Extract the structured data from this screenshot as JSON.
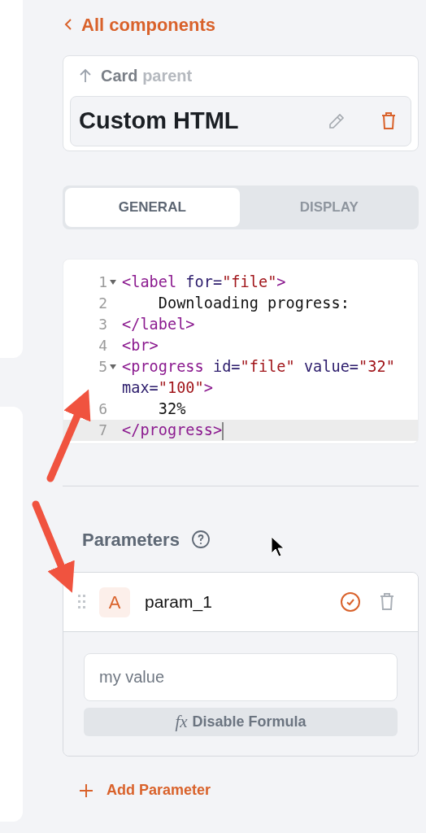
{
  "back_link": {
    "label": "All components"
  },
  "parent_card": {
    "type_label": "Card",
    "suffix": "parent",
    "component_name": "Custom HTML"
  },
  "tabs": [
    {
      "label": "GENERAL",
      "selected": true
    },
    {
      "label": "DISPLAY",
      "selected": false
    }
  ],
  "code_editor": {
    "lines": [
      {
        "number": "1",
        "fold": true,
        "active": false,
        "tokens": [
          {
            "kind": "tag",
            "text": "<label"
          },
          {
            "kind": "attr",
            "text": " for="
          },
          {
            "kind": "string",
            "text": "\"file\""
          },
          {
            "kind": "tag",
            "text": ">"
          }
        ]
      },
      {
        "number": "2",
        "fold": false,
        "active": false,
        "tokens": [
          {
            "kind": "text",
            "text": "    Downloading progress:"
          }
        ]
      },
      {
        "number": "3",
        "fold": false,
        "active": false,
        "tokens": [
          {
            "kind": "tag",
            "text": "</label>"
          }
        ]
      },
      {
        "number": "4",
        "fold": false,
        "active": false,
        "tokens": [
          {
            "kind": "tag",
            "text": "<br>"
          }
        ]
      },
      {
        "number": "5",
        "fold": true,
        "active": false,
        "tokens": [
          {
            "kind": "tag",
            "text": "<progress"
          },
          {
            "kind": "attr",
            "text": " id="
          },
          {
            "kind": "string",
            "text": "\"file\""
          },
          {
            "kind": "attr",
            "text": " value="
          },
          {
            "kind": "string",
            "text": "\"32\""
          },
          {
            "kind": "attr",
            "text": " max="
          },
          {
            "kind": "string",
            "text": "\"100\""
          },
          {
            "kind": "tag",
            "text": ">"
          }
        ]
      },
      {
        "number": "6",
        "fold": false,
        "active": false,
        "tokens": [
          {
            "kind": "text",
            "text": "    32%"
          }
        ]
      },
      {
        "number": "7",
        "fold": false,
        "active": true,
        "tokens": [
          {
            "kind": "tag",
            "text": "</progress>"
          }
        ]
      }
    ]
  },
  "parameters": {
    "title": "Parameters",
    "items": [
      {
        "type_badge": "A",
        "name": "param_1",
        "placeholder": "my value",
        "formula_button": {
          "icon_text": "fx",
          "label": "Disable Formula"
        }
      }
    ],
    "add_button": "Add Parameter"
  }
}
